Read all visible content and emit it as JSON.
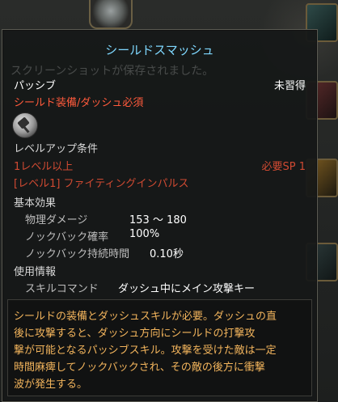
{
  "tooltip": {
    "title": "シールドスマッシュ",
    "system_message": "スクリーンショットが保存されました。",
    "type": "パッシブ",
    "learn_status": "未習得",
    "requirement": "シールド装備/ダッシュ必須",
    "icon": "shield-bash-skill-icon",
    "level_up_heading": "レベルアップ条件",
    "level_requirement": "1レベル以上",
    "sp_requirement": "必要SP 1",
    "prerequisite_skill": "[レベル1] ファイティングインパルス",
    "basic_effect_heading": "基本効果",
    "stats": [
      {
        "label": "物理ダメージ",
        "value": "153 ～ 180"
      },
      {
        "label": "ノックバック確率",
        "value": "100%"
      },
      {
        "label": "ノックバック持続時間",
        "value": "0.10秒"
      }
    ],
    "usage_heading": "使用情報",
    "skill_command_label": "スキルコマンド",
    "skill_command_value": "ダッシュ中にメイン攻撃キー",
    "description": "シールドの装備とダッシュスキルが必要。ダッシュの直\n後に攻撃すると、ダッシュ方向にシールドの打撃攻\n撃が可能となるパッシブスキル。攻撃を受けた敵は一定\n時間麻痺してノックバックされ、その敵の後方に衝撃\n波が発生する。"
  },
  "colors": {
    "title": "#7fd8ff",
    "requirement": "#ff5a3c",
    "locked": "#d04a32",
    "description": "#f2b45c"
  }
}
